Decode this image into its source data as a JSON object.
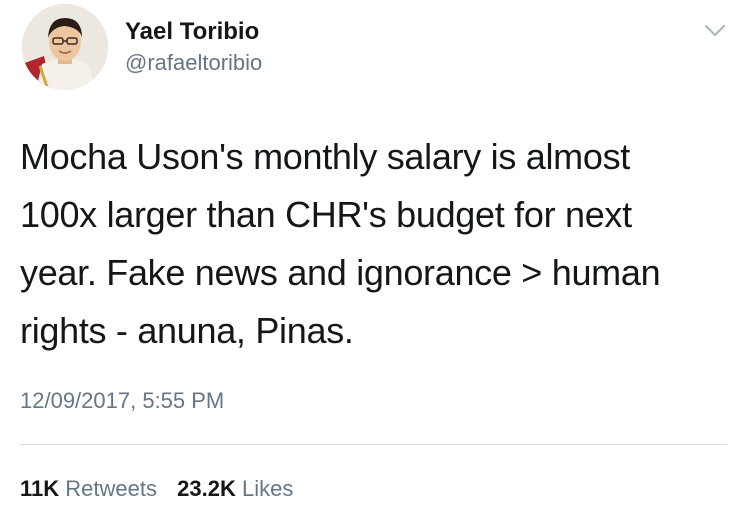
{
  "tweet": {
    "author_name": "Yael Toribio",
    "handle": "@rafaeltoribio",
    "text_lines": [
      "Mocha Uson's monthly salary is almost",
      "100x larger than CHR's budget for next",
      "year. Fake news and ignorance > human",
      "rights - anuna, Pinas."
    ],
    "timestamp": "12/09/2017, 5:55 PM",
    "retweets_count": "11K",
    "retweets_label": "Retweets",
    "likes_count": "23.2K",
    "likes_label": "Likes"
  },
  "icons": {
    "avatar": "profile-photo",
    "menu": "chevron-down-icon"
  },
  "colors": {
    "primary_text": "#14171a",
    "secondary_text": "#657786",
    "divider": "#d6dde3",
    "caret": "#aab8c2"
  }
}
